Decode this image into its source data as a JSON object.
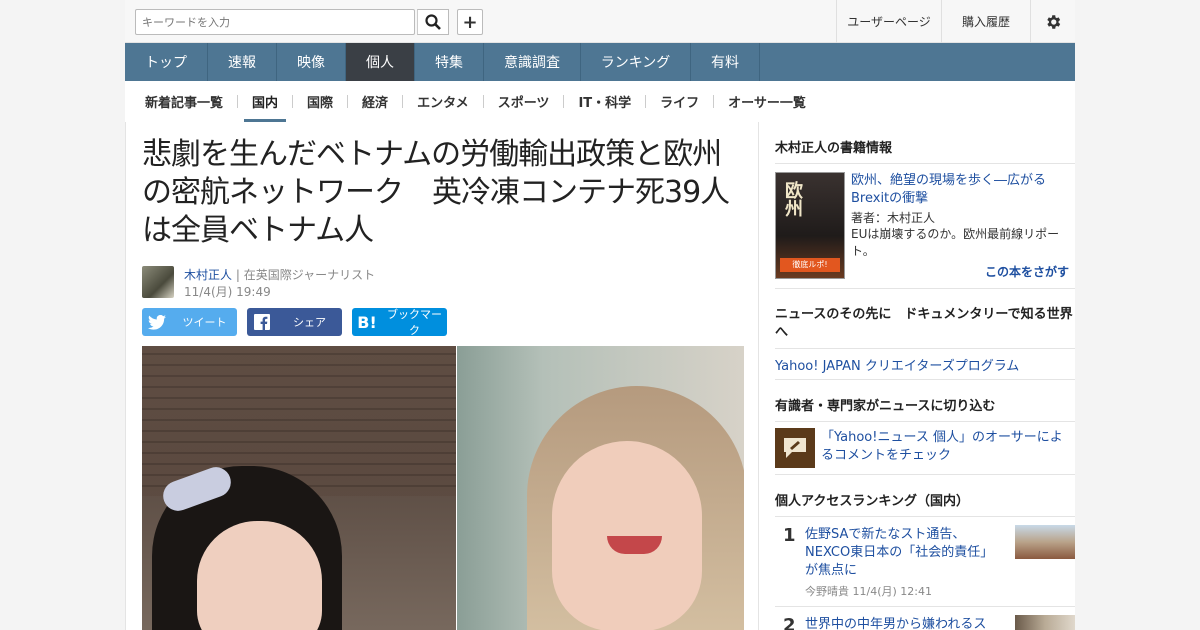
{
  "header": {
    "search_placeholder": "キーワードを入力",
    "plus_label": "+",
    "user_page": "ユーザーページ",
    "purchase_history": "購入履歴"
  },
  "main_nav": [
    {
      "label": "トップ",
      "active": false
    },
    {
      "label": "速報",
      "active": false
    },
    {
      "label": "映像",
      "active": false
    },
    {
      "label": "個人",
      "active": true
    },
    {
      "label": "特集",
      "active": false
    },
    {
      "label": "意識調査",
      "active": false
    },
    {
      "label": "ランキング",
      "active": false
    },
    {
      "label": "有料",
      "active": false
    }
  ],
  "sub_nav": [
    {
      "label": "新着記事一覧",
      "active": false
    },
    {
      "label": "国内",
      "active": true
    },
    {
      "label": "国際",
      "active": false
    },
    {
      "label": "経済",
      "active": false
    },
    {
      "label": "エンタメ",
      "active": false
    },
    {
      "label": "スポーツ",
      "active": false
    },
    {
      "label": "IT・科学",
      "active": false
    },
    {
      "label": "ライフ",
      "active": false
    },
    {
      "label": "オーサー一覧",
      "active": false
    }
  ],
  "article": {
    "title": "悲劇を生んだベトナムの労働輸出政策と欧州の密航ネットワーク　英冷凍コンテナ死39人は全員ベトナム人",
    "author_name": "木村正人",
    "author_role": "| 在英国際ジャーナリスト",
    "date": "11/4(月) 19:49",
    "share": {
      "twitter": "ツイート",
      "facebook": "シェア",
      "hatena": "ブックマーク"
    }
  },
  "sidebar": {
    "books_heading": "木村正人の書籍情報",
    "book": {
      "cover_title": "欧州",
      "cover_band": "徹底ルポ!",
      "title": "欧州、絶望の現場を歩く―広がるBrexitの衝撃",
      "author": "著者：木村正人",
      "desc": "EUは崩壊するのか。欧州最前線リポート。",
      "find_label": "この本をさがす"
    },
    "doc_heading": "ニュースのその先に　ドキュメンタリーで知る世界へ",
    "doc_link": "Yahoo! JAPAN クリエイターズプログラム",
    "expert_heading": "有識者・専門家がニュースに切り込む",
    "expert_link": "「Yahoo!ニュース 個人」のオーサーによるコメントをチェック",
    "ranking_heading": "個人アクセスランキング（国内）",
    "ranking": [
      {
        "rank": "1",
        "title": "佐野SAで新たなスト通告、NEXCO東日本の「社会的責任」が焦点に",
        "meta": "今野晴貴  11/4(月) 12:41"
      },
      {
        "rank": "2",
        "title": "世界中の中年男から嫌われるス",
        "meta": ""
      }
    ]
  },
  "colors": {
    "nav": "#4e7693",
    "nav_active": "#3a3f45",
    "link": "#1e4fa0",
    "twitter": "#55acee",
    "facebook": "#3b5998",
    "hatena": "#008fde"
  }
}
